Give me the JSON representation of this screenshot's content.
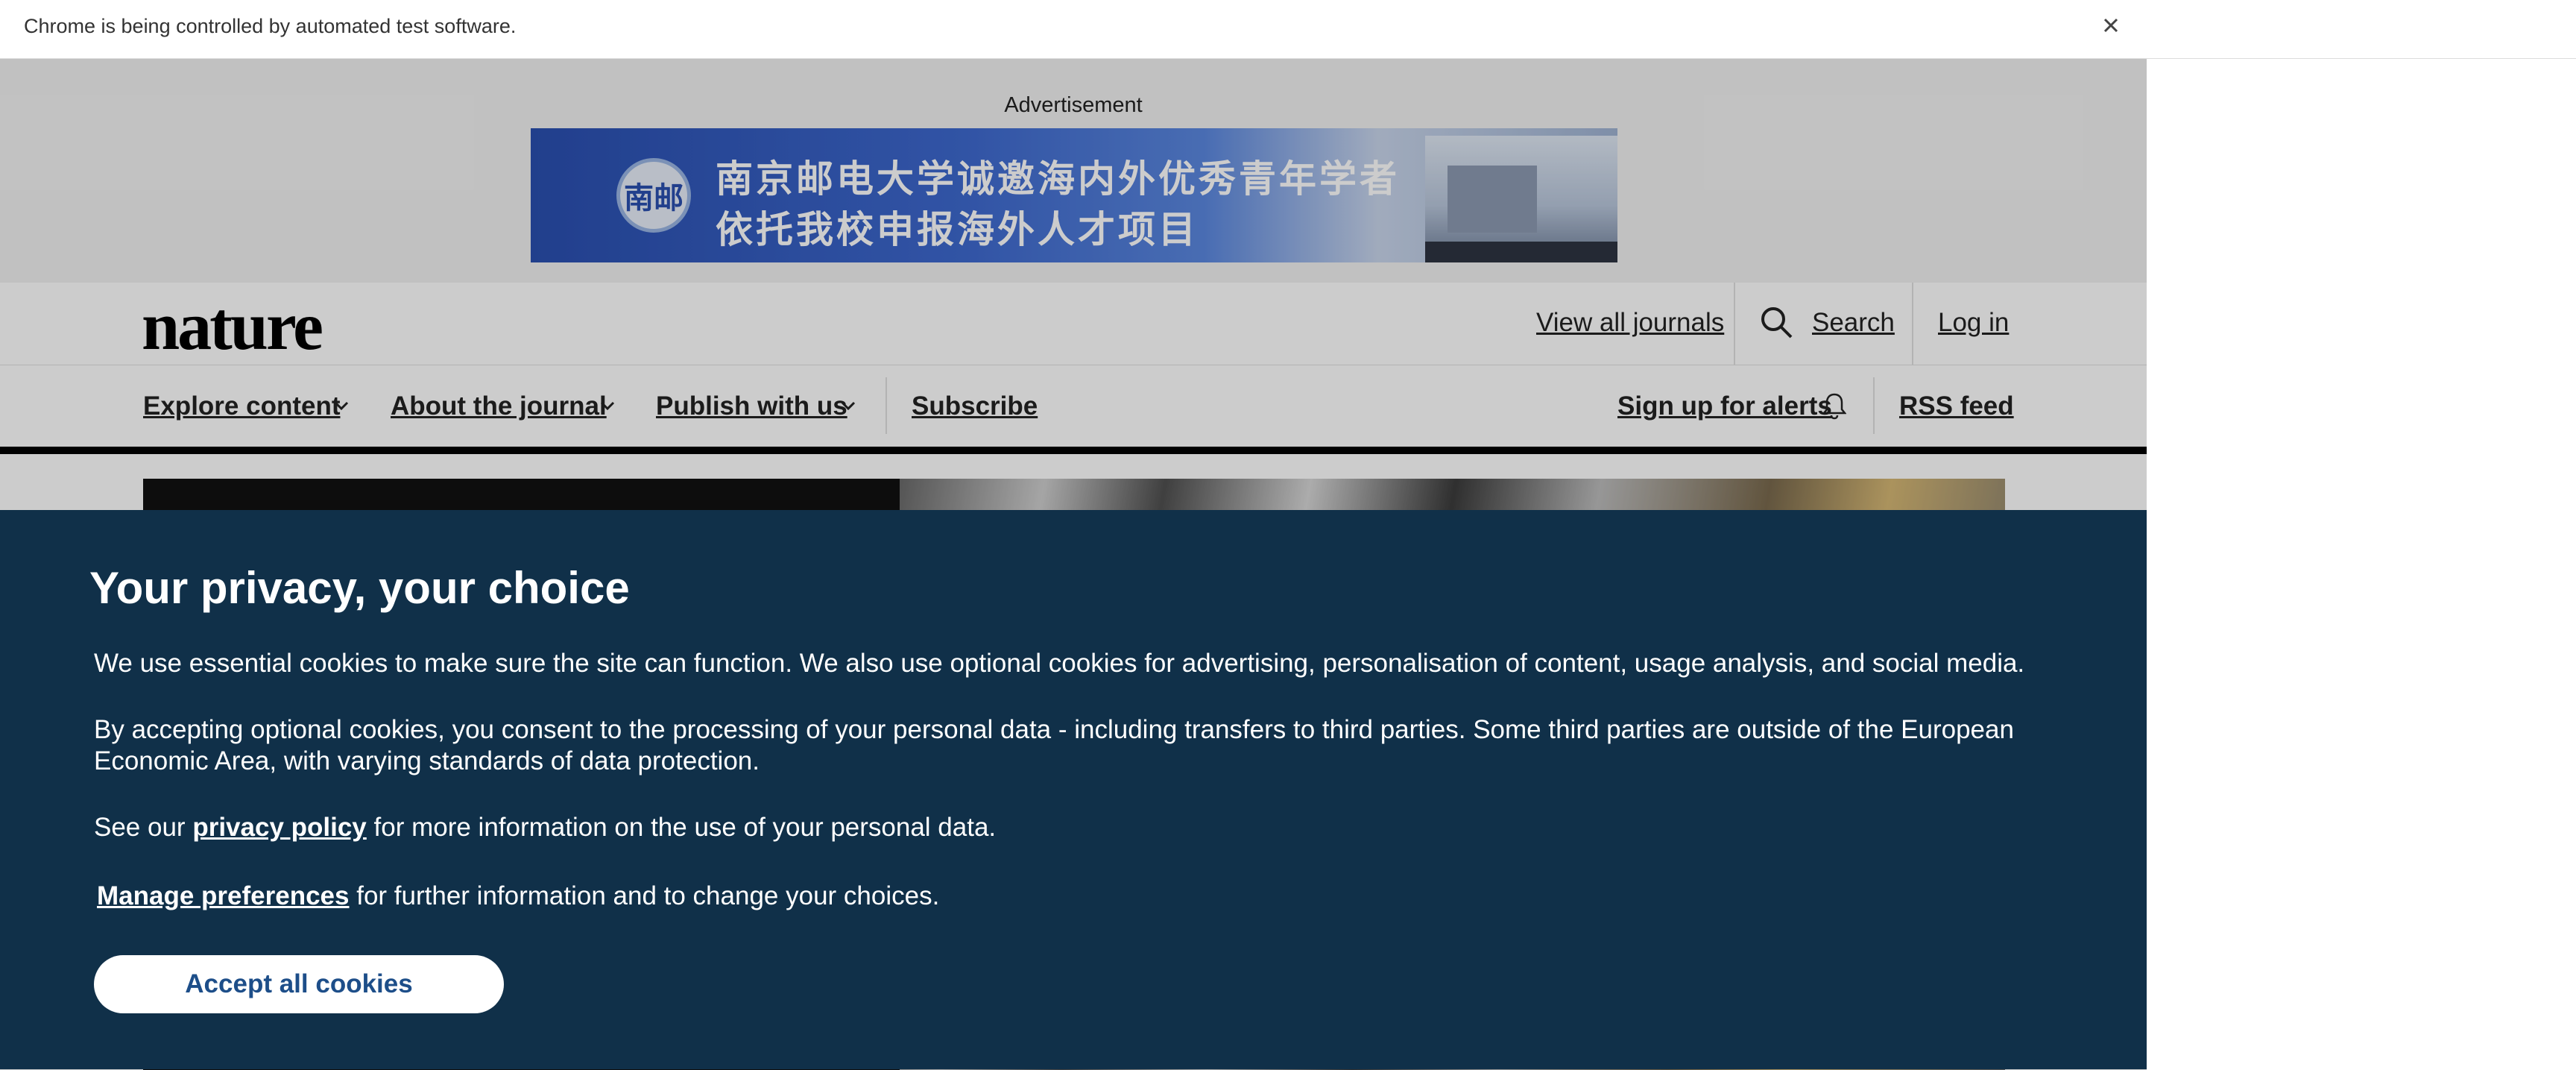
{
  "browser": {
    "infobar_text": "Chrome is being controlled by automated test software.",
    "close_icon": "close-icon"
  },
  "ad": {
    "label": "Advertisement",
    "banner_line1": "南京邮电大学诚邀海内外优秀青年学者",
    "banner_line2": "依托我校申报海外人才项目",
    "emblem_text": "南邮"
  },
  "header": {
    "logo": "nature",
    "view_all_journals": "View all journals",
    "search": "Search",
    "log_in": "Log in"
  },
  "nav": {
    "explore_content": "Explore content",
    "about_journal": "About the journal",
    "publish_with_us": "Publish with us",
    "subscribe": "Subscribe",
    "sign_up_alerts": "Sign up for alerts",
    "rss_feed": "RSS feed"
  },
  "cookie": {
    "title": "Your privacy, your choice",
    "p1": "We use essential cookies to make sure the site can function. We also use optional cookies for advertising, personalisation of content, usage analysis, and social media.",
    "p2": "By accepting optional cookies, you consent to the processing of your personal data - including transfers to third parties. Some third parties are outside of the European Economic Area, with varying standards of data protection.",
    "p3_prefix": "See our",
    "privacy_policy": "privacy policy",
    "p3_suffix": "for more information on the use of your personal data.",
    "manage_preferences": "Manage preferences",
    "p4_suffix": "for further information and to change your choices.",
    "accept_all": "Accept all cookies"
  },
  "colors": {
    "cookie_bg": "#103049",
    "accept_text": "#1d4e89",
    "nav_rule": "#000000"
  }
}
